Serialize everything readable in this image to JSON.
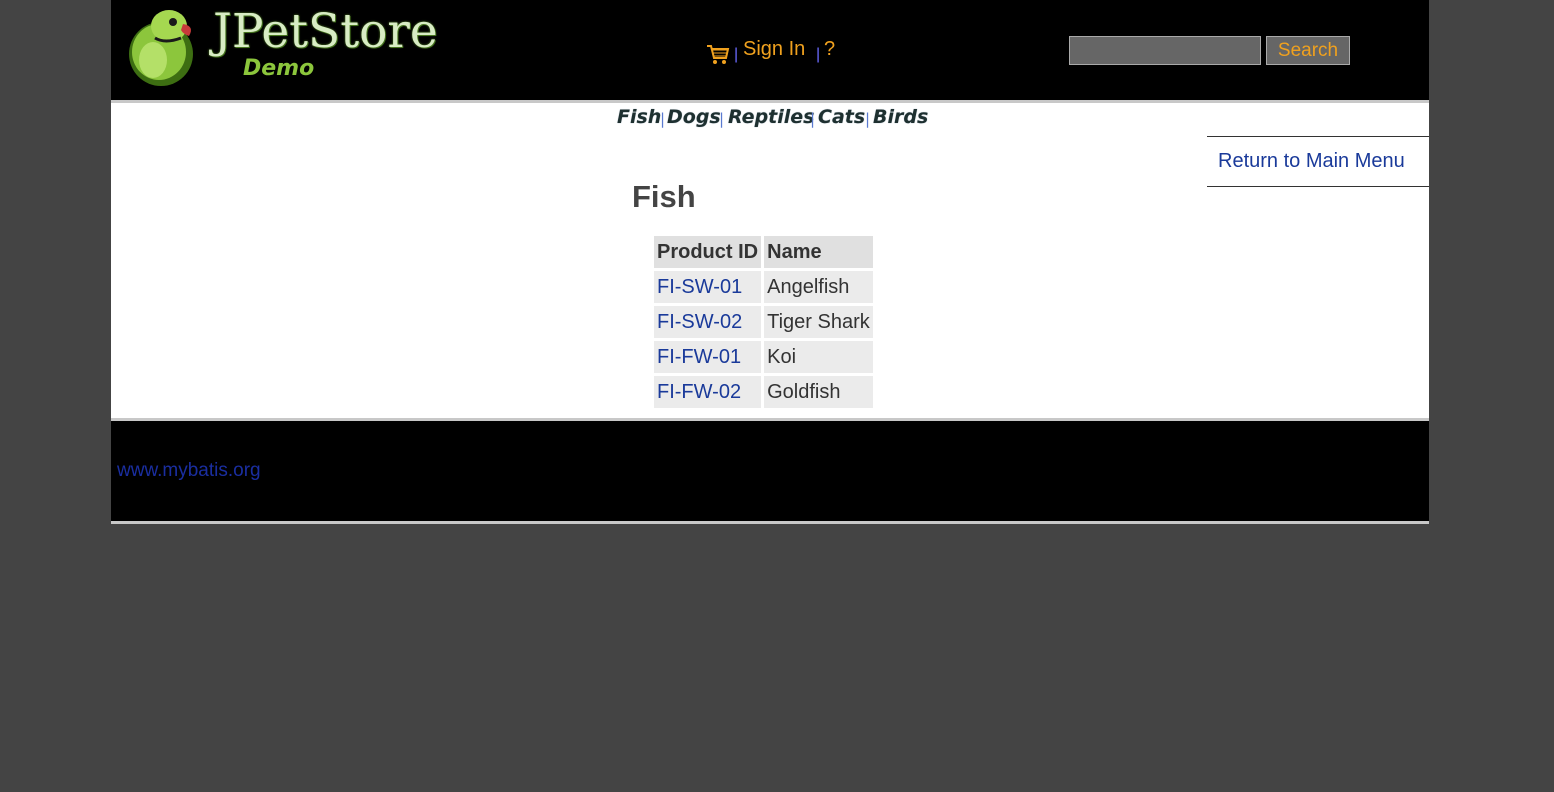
{
  "header": {
    "brand": "JPetStore",
    "brand_sub": "Demo",
    "menu": {
      "sign_in": "Sign In",
      "help": "?",
      "separator": "|"
    },
    "search": {
      "keyword_value": "",
      "button_label": "Search"
    }
  },
  "quicklinks": [
    "Fish",
    "Dogs",
    "Reptiles",
    "Cats",
    "Birds"
  ],
  "back_link": "Return to Main Menu",
  "category": {
    "title": "Fish",
    "columns": [
      "Product ID",
      "Name"
    ],
    "products": [
      {
        "id": "FI-SW-01",
        "name": "Angelfish"
      },
      {
        "id": "FI-SW-02",
        "name": "Tiger Shark"
      },
      {
        "id": "FI-FW-01",
        "name": "Koi"
      },
      {
        "id": "FI-FW-02",
        "name": "Goldfish"
      }
    ]
  },
  "footer": {
    "link": "www.mybatis.org"
  },
  "colors": {
    "page_bg": "#444444",
    "header_bg": "#000000",
    "menu_orange": "#f0a11e",
    "link_blue": "#1a3a9a"
  }
}
